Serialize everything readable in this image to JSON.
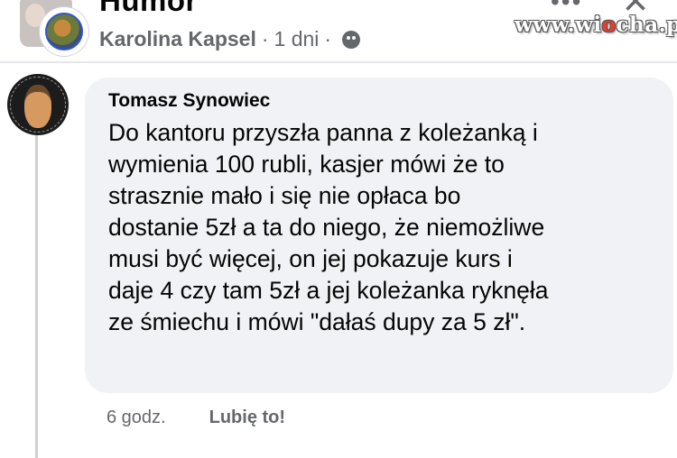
{
  "post": {
    "group_title": "Humor",
    "author": "Karolina Kapsel",
    "separator": "·",
    "time": "1 dni",
    "privacy_icon": "friends-icon",
    "more_icon": "more-dots-icon",
    "close_icon": "close-icon",
    "watermark_prefix": "www.wi",
    "watermark_accent": "o",
    "watermark_suffix": "cha.pl"
  },
  "comment": {
    "author": "Tomasz Synowiec",
    "text": "Do kantoru przyszła panna z koleżanką i\nwymienia 100 rubli, kasjer mówi że to\nstrasznie mało i się nie opłaca bo\ndostanie 5zł a ta do niego, że niemożliwe\nmusi być więcej, on jej pokazuje kurs i\ndaje 4 czy tam 5zł a jej koleżanka ryknęła\nze śmiechu i mówi \"dałaś dupy za 5 zł\".",
    "time": "6 godz.",
    "like_label": "Lubię to!"
  },
  "colors": {
    "bubble_bg": "#f0f2f5",
    "secondary_text": "#65676b",
    "primary_text": "#050505",
    "watermark_accent": "#f03a2a"
  }
}
